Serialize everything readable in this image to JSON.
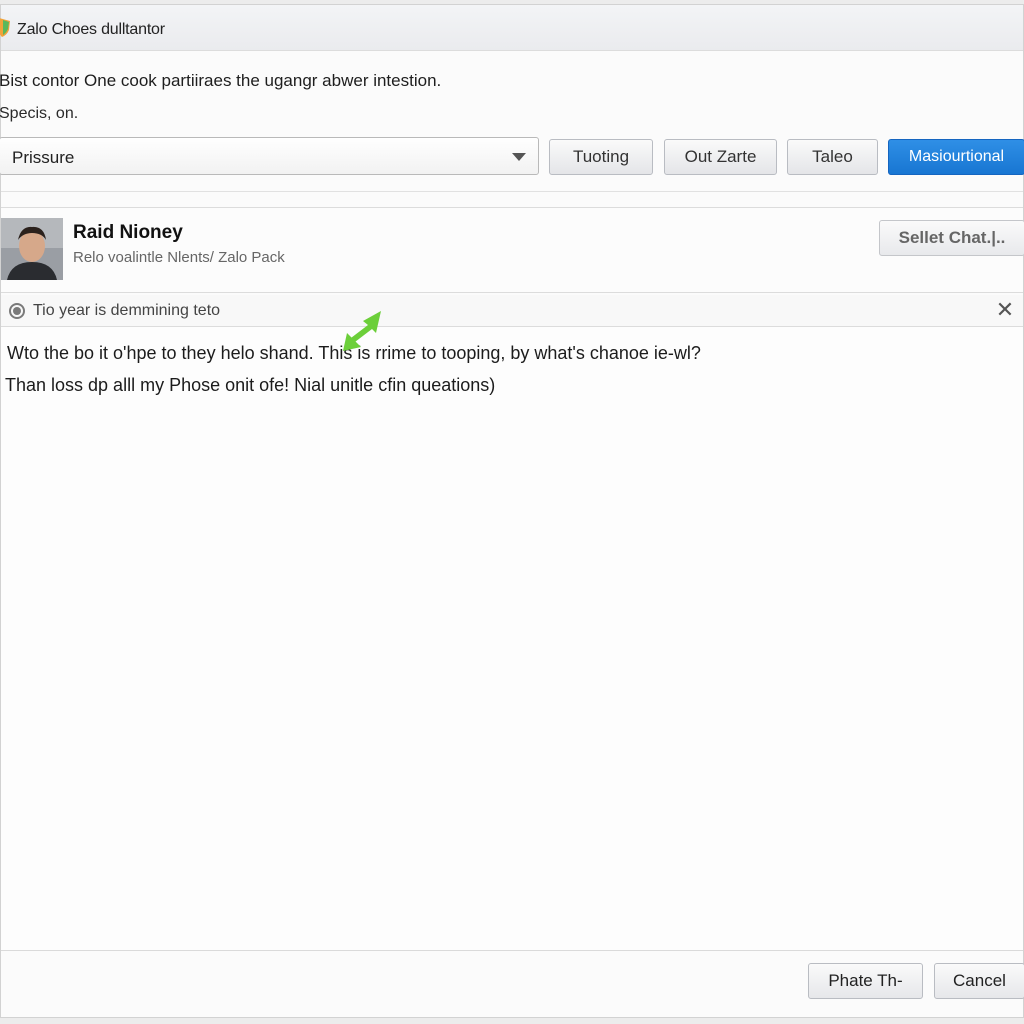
{
  "window": {
    "title": "Zalo Choes dulltantor"
  },
  "content": {
    "description": "Bist contor One cook partiiraes the ugangr abwer intestion.",
    "subdescription": "Specis, on."
  },
  "toolbar": {
    "select_value": "Prissure",
    "buttons": [
      "Tuoting",
      "Out Zarte",
      "Taleo"
    ],
    "primary_button": "Masiourtional"
  },
  "contact": {
    "name": "Raid Nioney",
    "subtitle": "Relo voalintle Nlents/ Zalo Pack",
    "select_chat_label": "Sellet Chat.|.."
  },
  "notice": {
    "text": "Tio year is demmining teto",
    "close_symbol": "✕"
  },
  "message": {
    "line1": "Wto the bo it oʹhpe to they helo shand. This is rrime to tooping, by what's chanoe ie-wl?",
    "line2": "Than loss dp alll my Phose onit ofe! Nial unitle cfin queations)"
  },
  "footer": {
    "confirm_label": "Phate Th-",
    "cancel_label": "Cancel"
  },
  "colors": {
    "primary": "#1876d2",
    "cursor": "#6ccf3a",
    "app_icon": "#f2a33a"
  },
  "icons": {
    "app": "shield-logo-icon",
    "notice": "radio-circle-icon",
    "close": "close-icon",
    "dropdown": "chevron-down-icon",
    "cursor": "green-arrow-cursor-icon"
  }
}
